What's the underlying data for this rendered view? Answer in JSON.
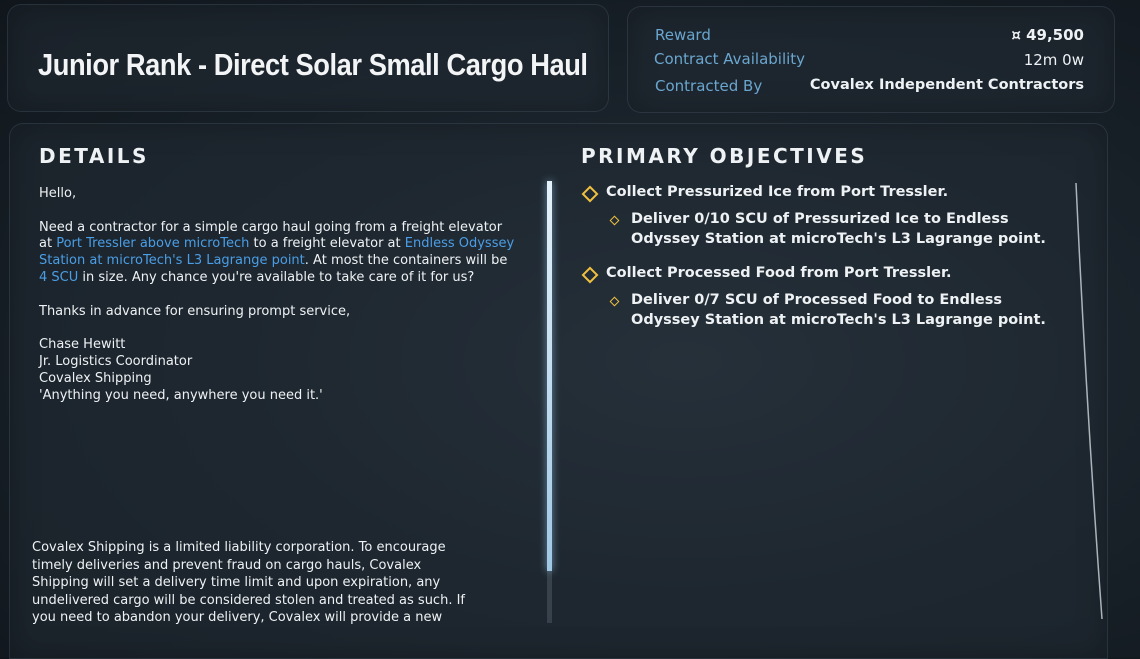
{
  "title": "Junior Rank - Direct Solar Small Cargo Haul",
  "summary": {
    "reward_label": "Reward",
    "reward_value": "¤ 49,500",
    "availability_label": "Contract Availability",
    "availability_value": "12m 0w",
    "contracted_by_label": "Contracted By",
    "contracted_by_value": "Covalex Independent Contractors"
  },
  "details": {
    "heading": "DETAILS",
    "greeting": "Hello,",
    "body": {
      "t1": "Need a contractor for a simple cargo haul going from a freight elevator at ",
      "link1": "Port Tressler above microTech",
      "t2": " to a freight elevator at ",
      "link2": "Endless Odyssey Station at microTech's L3 Lagrange point",
      "t3": ". At most the containers will be ",
      "link3": "4 SCU",
      "t4": " in size. Any chance you're available to take care of it for us?"
    },
    "thanks": "Thanks in advance for ensuring prompt service,",
    "signature": {
      "name": "Chase Hewitt",
      "role": "Jr. Logistics Coordinator",
      "company": "Covalex Shipping",
      "motto": "'Anything you need, anywhere you need it.'"
    },
    "disclaimer": "Covalex Shipping is a limited liability corporation. To encourage timely deliveries and prevent fraud on cargo hauls, Covalex Shipping will set a delivery time limit and upon expiration, any undelivered cargo will be considered stolen and treated as such. If you need to abandon your delivery, Covalex will provide a new drop"
  },
  "objectives": {
    "heading": "PRIMARY OBJECTIVES",
    "items": [
      {
        "label": "Collect Pressurized Ice from Port Tressler.",
        "sub": [
          "Deliver 0/10 SCU of Pressurized Ice to Endless",
          "Odyssey Station at microTech's L3 Lagrange point."
        ]
      },
      {
        "label": "Collect Processed Food from Port Tressler.",
        "sub": [
          "Deliver 0/7 SCU of Processed Food to Endless",
          "Odyssey Station at microTech's L3 Lagrange point."
        ]
      }
    ]
  },
  "colors": {
    "accent": "#4a9ee6",
    "label_blue": "#6aa6cf",
    "objective_marker": "#f0c040"
  }
}
